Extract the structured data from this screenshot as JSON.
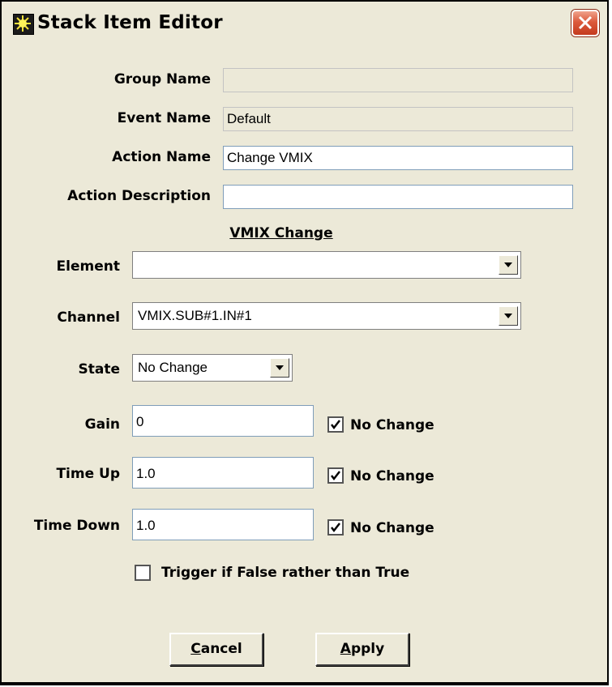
{
  "window": {
    "title": "Stack Item Editor",
    "app_icon": "sun-burst-icon",
    "close_icon": "close-icon"
  },
  "form": {
    "group_name_label": "Group Name",
    "group_name_value": "",
    "event_name_label": "Event Name",
    "event_name_value": "Default",
    "action_name_label": "Action Name",
    "action_name_value": "Change VMIX",
    "action_description_label": "Action Description",
    "action_description_value": ""
  },
  "section": {
    "title": "VMIX Change"
  },
  "vmix": {
    "element_label": "Element",
    "element_value": "",
    "channel_label": "Channel",
    "channel_value": "VMIX.SUB#1.IN#1",
    "state_label": "State",
    "state_value": "No Change",
    "gain_label": "Gain",
    "gain_value": "0",
    "gain_nochange_label": "No Change",
    "gain_nochange_checked": true,
    "timeup_label": "Time Up",
    "timeup_value": "1.0",
    "timeup_nochange_label": "No Change",
    "timeup_nochange_checked": true,
    "timedown_label": "Time Down",
    "timedown_value": "1.0",
    "timedown_nochange_label": "No Change",
    "timedown_nochange_checked": true,
    "trigger_label": "Trigger if False rather than True",
    "trigger_checked": false
  },
  "buttons": {
    "cancel_accel": "C",
    "cancel_rest": "ancel",
    "apply_accel": "A",
    "apply_rest": "pply"
  },
  "colors": {
    "dialog_bg": "#ece9d8",
    "close_button": "#dc5a3c",
    "field_border": "#7f9db9"
  }
}
